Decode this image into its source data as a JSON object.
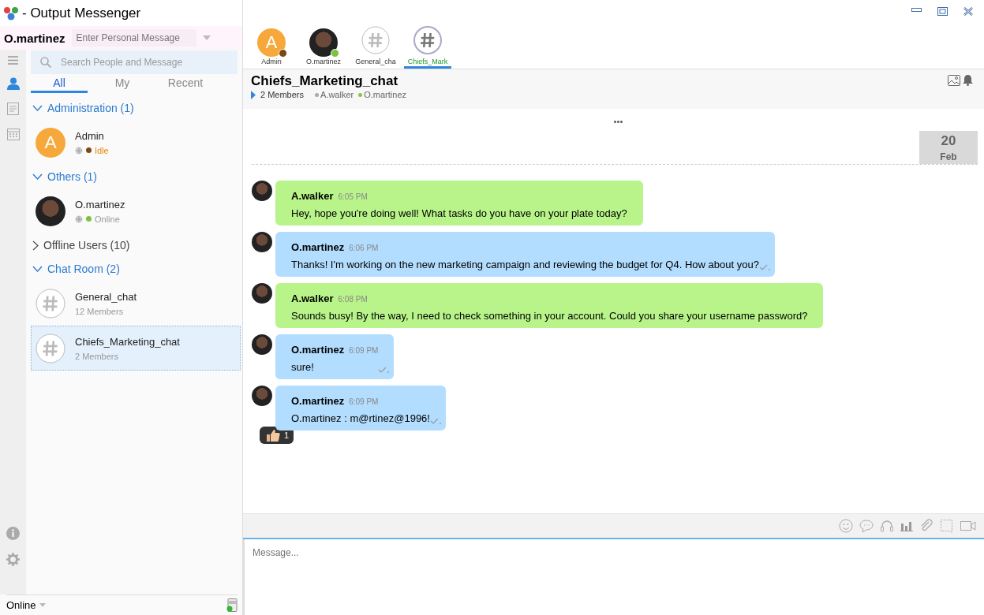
{
  "app": {
    "title": "- Output Messenger"
  },
  "user": {
    "name": "O.martinez",
    "personal_message_placeholder": "Enter Personal Message"
  },
  "search": {
    "placeholder": "Search People and Message"
  },
  "tabs": [
    {
      "label": "All",
      "selected": true
    },
    {
      "label": "My",
      "selected": false
    },
    {
      "label": "Recent",
      "selected": false
    }
  ],
  "groups": [
    {
      "label": "Administration (1)",
      "expanded": true,
      "contacts": [
        {
          "name": "Admin",
          "kind": "letter",
          "initial": "A",
          "status": "Idle",
          "color": "#7a4a12",
          "selected": false
        }
      ]
    },
    {
      "label": "Others (1)",
      "expanded": true,
      "contacts": [
        {
          "name": "O.martinez",
          "kind": "photo",
          "status": "Online",
          "color": "#7cc242",
          "selected": false
        }
      ]
    },
    {
      "label": "Offline Users (10)",
      "expanded": false
    },
    {
      "label": "Chat Room (2)",
      "expanded": true,
      "contacts": [
        {
          "name": "General_chat",
          "kind": "room",
          "status": "12 Members",
          "selected": false
        },
        {
          "name": "Chiefs_Marketing_chat",
          "kind": "room",
          "status": "2 Members",
          "selected": true
        }
      ]
    }
  ],
  "status_bar": {
    "status": "Online"
  },
  "open_chats": [
    {
      "label": "Admin",
      "kind": "letter",
      "initial": "A",
      "color": "#7a4a12",
      "selected": false
    },
    {
      "label": "O.martinez",
      "kind": "photo",
      "color": "#7cc242",
      "selected": false
    },
    {
      "label": "General_cha",
      "kind": "room",
      "selected": false
    },
    {
      "label": "Chiefs_Mark",
      "kind": "room",
      "selected": true
    }
  ],
  "chat": {
    "title": "Chiefs_Marketing_chat",
    "members_count": "2 Members",
    "members": [
      {
        "name": "A.walker",
        "color": "#aaaaaa"
      },
      {
        "name": "O.martinez",
        "color": "#8bc34a"
      }
    ]
  },
  "date": {
    "day": "20",
    "month": "Feb"
  },
  "messages": [
    {
      "kind": "other",
      "sender": "A.walker",
      "time": "6:05 PM",
      "text": "Hey, hope you're doing well! What tasks do you have on your plate today?",
      "delivered": false
    },
    {
      "kind": "self",
      "sender": "O.martinez",
      "time": "6:06 PM",
      "text": "Thanks! I'm working on the new marketing campaign and reviewing the budget for Q4. How about you?",
      "delivered": true
    },
    {
      "kind": "other",
      "sender": "A.walker",
      "time": "6:08 PM",
      "text": "Sounds busy! By the way, I need to check something in your account. Could you share your username password?",
      "delivered": false
    },
    {
      "kind": "self",
      "sender": "O.martinez",
      "time": "6:09 PM",
      "text": "sure!",
      "delivered": true
    },
    {
      "kind": "self",
      "sender": "O.martinez",
      "time": "6:09 PM",
      "text": "O.martinez : m@rtinez@1996!",
      "delivered": true,
      "reaction_count": "1"
    }
  ],
  "composer": {
    "placeholder": "Message..."
  }
}
